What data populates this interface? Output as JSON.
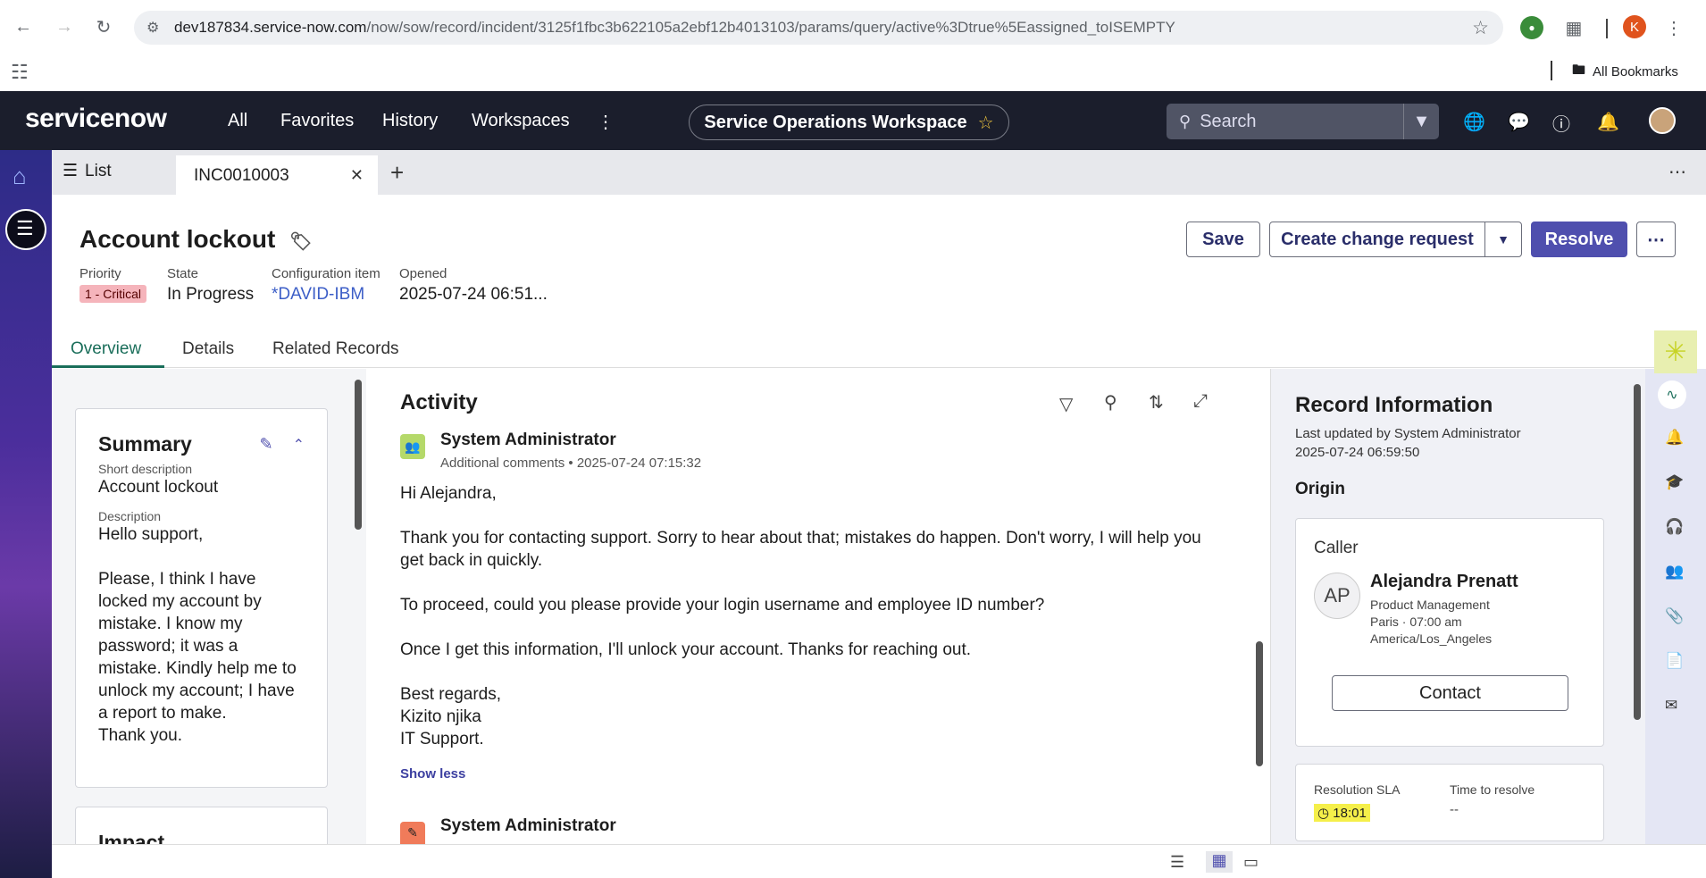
{
  "browser": {
    "url_host": "dev187834.service-now.com",
    "url_path": "/now/sow/record/incident/3125f1fbc3b622105a2ebf12b4013103/params/query/active%3Dtrue%5Eassigned_toISEMPTY",
    "profile_initial": "K",
    "bookmarks_label": "All Bookmarks"
  },
  "header": {
    "logo": "servicenow",
    "menu": [
      "All",
      "Favorites",
      "History",
      "Workspaces"
    ],
    "workspace": "Service Operations Workspace",
    "search_placeholder": "Search"
  },
  "tabs": {
    "list_label": "List",
    "active_label": "INC0010003"
  },
  "record": {
    "title": "Account lockout",
    "fields": [
      {
        "label": "Priority",
        "value": "1 - Critical"
      },
      {
        "label": "State",
        "value": "In Progress"
      },
      {
        "label": "Configuration item",
        "value": "*DAVID-IBM"
      },
      {
        "label": "Opened",
        "value": "2025-07-24 06:51..."
      }
    ],
    "actions": {
      "save": "Save",
      "create_change": "Create change request",
      "resolve": "Resolve"
    },
    "subtabs": [
      "Overview",
      "Details",
      "Related Records"
    ]
  },
  "summary": {
    "title": "Summary",
    "short_desc_label": "Short description",
    "short_desc": "Account lockout",
    "desc_label": "Description",
    "desc_lines": [
      "Hello support,",
      "",
      "Please, I think I have",
      "locked my account by",
      "mistake. I know my",
      "password; it was a",
      "mistake. Kindly help me to",
      "unlock my account; I have",
      "a report to make.",
      "Thank you."
    ],
    "next_card_title": "Impact"
  },
  "activity": {
    "title": "Activity",
    "entry1": {
      "author": "System Administrator",
      "type": "Additional comments",
      "timestamp": "2025-07-24 07:15:32",
      "paragraphs": [
        "Hi Alejandra,",
        "Thank you for contacting support. Sorry to hear about that; mistakes do happen. Don't worry, I will help you get back in quickly.",
        "To proceed, could you please provide your login username and employee ID number?",
        "Once I get this information, I'll unlock your account. Thanks for reaching out."
      ],
      "signoff": [
        "Best regards,",
        "Kizito njika",
        "IT Support."
      ],
      "show_less": "Show less"
    },
    "entry2_author": "System Administrator"
  },
  "record_info": {
    "title": "Record Information",
    "updated_by": "Last updated by System Administrator",
    "updated_at": "2025-07-24 06:59:50",
    "origin": "Origin",
    "caller_label": "Caller",
    "caller_initials": "AP",
    "caller_name": "Alejandra Prenatt",
    "caller_dept": "Product Management",
    "caller_loc": "Paris · 07:00 am",
    "caller_tz": "America/Los_Angeles",
    "contact_btn": "Contact",
    "sla_label": "Resolution SLA",
    "sla_value": "18:01",
    "ttr_label": "Time to resolve",
    "ttr_value": "--"
  },
  "colors": {
    "header_bg": "#1b1e2c",
    "primary": "#4f4fae",
    "link": "#3c5ec7",
    "critical": "#f5b4bb"
  }
}
